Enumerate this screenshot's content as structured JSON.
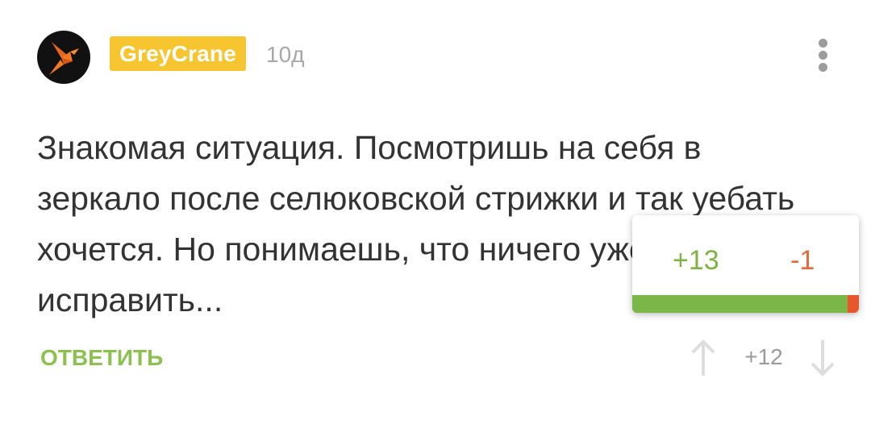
{
  "comment": {
    "author": "GreyCrane",
    "time": "10д",
    "text": "Знакомая ситуация. Посмотришь на себя в зеркало после селюковской стрижки и так уебать хочется. Но понимаешь, что ничего уже не исправить...",
    "reply_label": "ОТВЕТИТЬ",
    "rating": "+12"
  },
  "vote_popup": {
    "pros": "+13",
    "cons": "-1",
    "positive_share": 0.95
  },
  "icons": {
    "avatar": "crane-logo-icon",
    "more": "more-vertical-icon",
    "upvote": "arrow-up-icon",
    "downvote": "arrow-down-icon"
  },
  "colors": {
    "username_bg": "#f7c530",
    "reply": "#8cc152",
    "pros": "#7cb342",
    "cons": "#e06a39",
    "bar_positive": "#7ab648",
    "bar_negative": "#e8572c"
  }
}
